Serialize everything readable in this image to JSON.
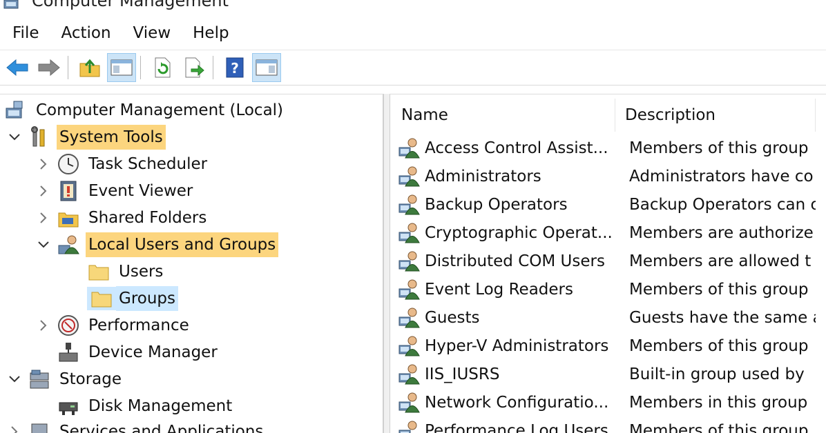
{
  "window": {
    "title": "Computer Management"
  },
  "menu": [
    "File",
    "Action",
    "View",
    "Help"
  ],
  "toolbar": {
    "buttons": [
      {
        "icon": "back-arrow-icon"
      },
      {
        "icon": "forward-arrow-icon"
      },
      {
        "icon": "up-folder-icon"
      },
      {
        "icon": "show-hide-console-tree-icon"
      },
      {
        "icon": "refresh-icon"
      },
      {
        "icon": "export-list-icon"
      },
      {
        "icon": "help-icon"
      },
      {
        "icon": "show-hide-action-pane-icon"
      }
    ]
  },
  "tree": {
    "root": "Computer Management (Local)",
    "system_tools": "System Tools",
    "task_scheduler": "Task Scheduler",
    "event_viewer": "Event Viewer",
    "shared_folders": "Shared Folders",
    "local_users_groups": "Local Users and Groups",
    "users": "Users",
    "groups": "Groups",
    "performance": "Performance",
    "device_manager": "Device Manager",
    "storage": "Storage",
    "disk_management": "Disk Management",
    "services_apps": "Services and Applications"
  },
  "list": {
    "columns": [
      "Name",
      "Description"
    ],
    "rows": [
      {
        "name": "Access Control Assist...",
        "desc": "Members of this group"
      },
      {
        "name": "Administrators",
        "desc": "Administrators have co"
      },
      {
        "name": "Backup Operators",
        "desc": "Backup Operators can o"
      },
      {
        "name": "Cryptographic Operat...",
        "desc": "Members are authorize"
      },
      {
        "name": "Distributed COM Users",
        "desc": "Members are allowed t"
      },
      {
        "name": "Event Log Readers",
        "desc": "Members of this group"
      },
      {
        "name": "Guests",
        "desc": "Guests have the same a"
      },
      {
        "name": "Hyper-V Administrators",
        "desc": "Members of this group"
      },
      {
        "name": "IIS_IUSRS",
        "desc": "Built-in group used by"
      },
      {
        "name": "Network Configuratio...",
        "desc": "Members in this group"
      },
      {
        "name": "Performance Log Users",
        "desc": "Members of this group"
      }
    ]
  },
  "colors": {
    "highlight": "#fcd57e",
    "selected": "#cce8ff",
    "pressed_button": "#cce4f7"
  }
}
